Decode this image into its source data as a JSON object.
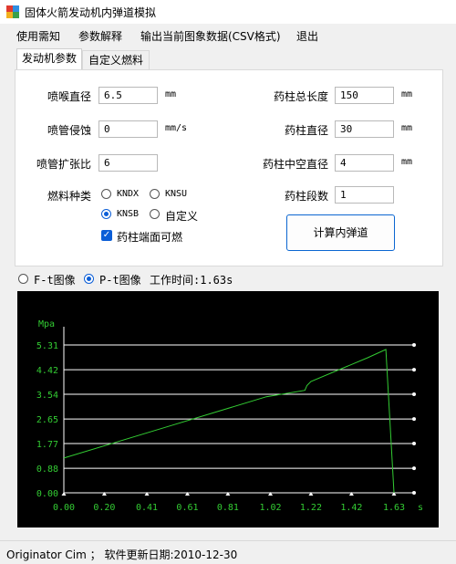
{
  "window": {
    "title": "固体火箭发动机内弹道模拟"
  },
  "menu": [
    "使用需知",
    "参数解释",
    "输出当前图象数据(CSV格式)",
    "退出"
  ],
  "tabs": [
    "发动机参数",
    "自定义燃料"
  ],
  "fields": {
    "throat_diameter": {
      "label": "喷喉直径",
      "value": "6.5",
      "unit": "mm"
    },
    "nozzle_erosion": {
      "label": "喷管侵蚀",
      "value": "0",
      "unit": "mm/s"
    },
    "expansion_ratio": {
      "label": "喷管扩张比",
      "value": "6"
    },
    "grain_length": {
      "label": "药柱总长度",
      "value": "150",
      "unit": "mm"
    },
    "grain_diameter": {
      "label": "药柱直径",
      "value": "30",
      "unit": "mm"
    },
    "core_diameter": {
      "label": "药柱中空直径",
      "value": "4",
      "unit": "mm"
    },
    "segments": {
      "label": "药柱段数",
      "value": "1"
    }
  },
  "fuel": {
    "label": "燃料种类",
    "options": [
      "KNDX",
      "KNSU",
      "KNSB",
      "自定义"
    ],
    "selected": "KNSB"
  },
  "end_burning": {
    "label": "药柱端面可燃",
    "checked": true
  },
  "calc_button": "计算内弹道",
  "plot_mode": {
    "options": [
      "F-t图像",
      "P-t图像"
    ],
    "selected": "P-t图像"
  },
  "work_time": "工作时间:1.63s",
  "chart_data": {
    "type": "line",
    "ylabel": "Mpa",
    "xlabel": "s",
    "yticks": [
      "0.00",
      "0.88",
      "1.77",
      "2.65",
      "3.54",
      "4.42",
      "5.31"
    ],
    "xticks": [
      "0.00",
      "0.20",
      "0.41",
      "0.61",
      "0.81",
      "1.02",
      "1.22",
      "1.42",
      "1.63"
    ],
    "ylim": [
      0,
      5.31
    ],
    "xlim": [
      0,
      1.63
    ],
    "series": [
      {
        "color": "#33cc33",
        "x": [
          0.0,
          0.5,
          1.0,
          1.19,
          1.2,
          1.22,
          1.5,
          1.59,
          1.63
        ],
        "y": [
          1.25,
          2.35,
          3.45,
          3.68,
          3.85,
          4.0,
          4.85,
          5.15,
          0.0
        ]
      }
    ],
    "grid": true,
    "background": "#000000",
    "grid_color": "#ffffff",
    "axis_label_color": "#33cc33"
  },
  "status": "Originator Cim ； 软件更新日期:2010-12-30"
}
